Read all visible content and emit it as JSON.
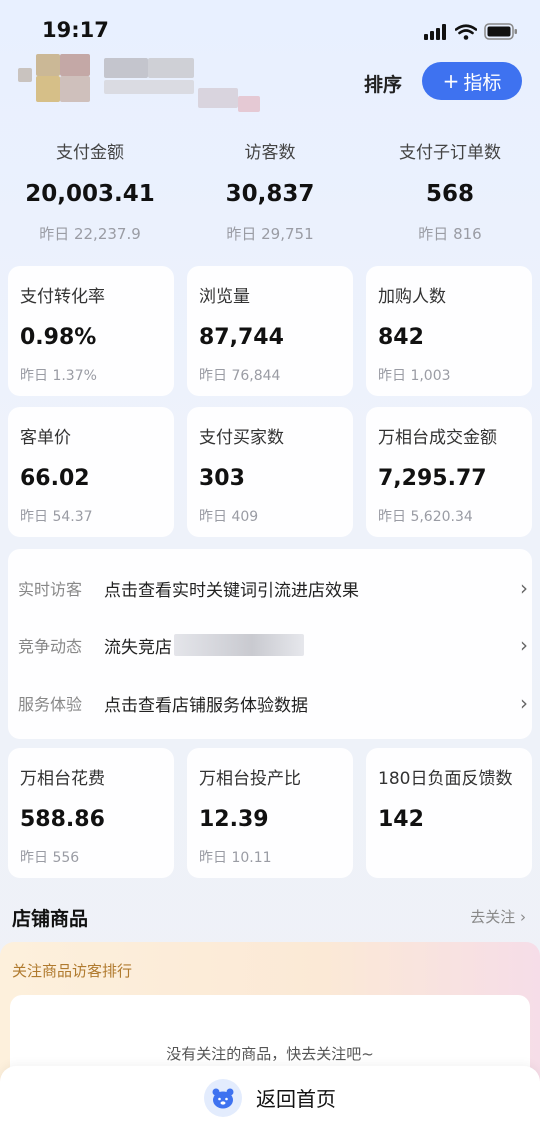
{
  "status_bar": {
    "time": "19:17"
  },
  "header": {
    "sort_label": "排序",
    "indicator_label": "指标",
    "indicator_plus": "+"
  },
  "top_metrics": [
    {
      "title": "支付金额",
      "value": "20,003.41",
      "yesterday": "昨日 22,237.9"
    },
    {
      "title": "访客数",
      "value": "30,837",
      "yesterday": "昨日 29,751"
    },
    {
      "title": "支付子订单数",
      "value": "568",
      "yesterday": "昨日 816"
    }
  ],
  "cards_row1": [
    {
      "title": "支付转化率",
      "value": "0.98%",
      "yesterday": "昨日 1.37%"
    },
    {
      "title": "浏览量",
      "value": "87,744",
      "yesterday": "昨日 76,844"
    },
    {
      "title": "加购人数",
      "value": "842",
      "yesterday": "昨日 1,003"
    }
  ],
  "cards_row2": [
    {
      "title": "客单价",
      "value": "66.02",
      "yesterday": "昨日 54.37"
    },
    {
      "title": "支付买家数",
      "value": "303",
      "yesterday": "昨日 409"
    },
    {
      "title": "万相台成交金额",
      "value": "7,295.77",
      "yesterday": "昨日 5,620.34"
    }
  ],
  "info_rows": [
    {
      "key": "实时访客",
      "desc": "点击查看实时关键词引流进店效果",
      "chevron": "›"
    },
    {
      "key": "竞争动态",
      "desc": "流失竞店",
      "chevron": "›"
    },
    {
      "key": "服务体验",
      "desc": "点击查看店铺服务体验数据",
      "chevron": "›"
    }
  ],
  "cards_row3": [
    {
      "title": "万相台花费",
      "value": "588.86",
      "yesterday": "昨日 556"
    },
    {
      "title": "万相台投产比",
      "value": "12.39",
      "yesterday": "昨日 10.11"
    },
    {
      "title": "180日负面反馈数",
      "value": "142"
    }
  ],
  "shop": {
    "title": "店铺商品",
    "link": "去关注 ›"
  },
  "favorites": {
    "title": "关注商品访客排行",
    "empty": "没有关注的商品，快去关注吧~"
  },
  "bottom": {
    "label": "返回首页"
  }
}
